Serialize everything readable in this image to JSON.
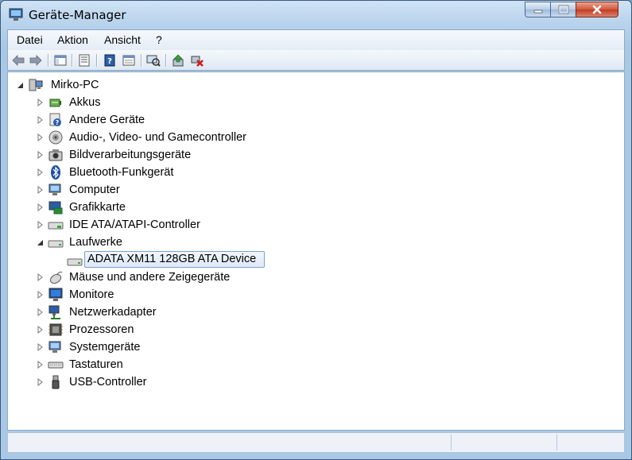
{
  "window": {
    "title": "Geräte-Manager"
  },
  "menu": [
    {
      "label": "Datei"
    },
    {
      "label": "Aktion"
    },
    {
      "label": "Ansicht"
    },
    {
      "label": "?"
    }
  ],
  "toolbar": [
    "back-arrow-icon",
    "forward-arrow-icon",
    "show-hide-console-tree-icon",
    "properties-icon",
    "help-icon",
    "view-icon",
    "scan-hardware-icon",
    "update-driver-icon",
    "uninstall-device-icon"
  ],
  "tree": {
    "root": {
      "label": "Mirko-PC",
      "icon": "computer-icon",
      "expanded": true
    },
    "categories": [
      {
        "label": "Akkus",
        "icon": "battery-icon",
        "expanded": false
      },
      {
        "label": "Andere Geräte",
        "icon": "unknown-device-icon",
        "expanded": false
      },
      {
        "label": "Audio-, Video- und Gamecontroller",
        "icon": "speaker-icon",
        "expanded": false
      },
      {
        "label": "Bildverarbeitungsgeräte",
        "icon": "camera-icon",
        "expanded": false
      },
      {
        "label": "Bluetooth-Funkgerät",
        "icon": "bluetooth-icon",
        "expanded": false
      },
      {
        "label": "Computer",
        "icon": "computer-monitor-icon",
        "expanded": false
      },
      {
        "label": "Grafikkarte",
        "icon": "display-adapter-icon",
        "expanded": false
      },
      {
        "label": "IDE ATA/ATAPI-Controller",
        "icon": "ide-controller-icon",
        "expanded": false
      },
      {
        "label": "Laufwerke",
        "icon": "disk-drive-icon",
        "expanded": true,
        "children": [
          {
            "label": "ADATA XM11 128GB ATA Device",
            "icon": "disk-drive-icon",
            "selected": true
          }
        ]
      },
      {
        "label": "Mäuse und andere Zeigegeräte",
        "icon": "mouse-icon",
        "expanded": false
      },
      {
        "label": "Monitore",
        "icon": "monitor-icon",
        "expanded": false
      },
      {
        "label": "Netzwerkadapter",
        "icon": "network-adapter-icon",
        "expanded": false
      },
      {
        "label": "Prozessoren",
        "icon": "processor-icon",
        "expanded": false
      },
      {
        "label": "Systemgeräte",
        "icon": "system-devices-icon",
        "expanded": false
      },
      {
        "label": "Tastaturen",
        "icon": "keyboard-icon",
        "expanded": false
      },
      {
        "label": "USB-Controller",
        "icon": "usb-icon",
        "expanded": false
      }
    ]
  },
  "status": {
    "text": ""
  }
}
